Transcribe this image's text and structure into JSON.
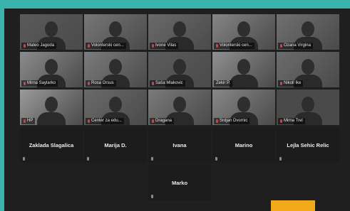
{
  "participants": [
    {
      "label": "Mateo Jagoda",
      "tone": "#5a5a5a"
    },
    {
      "label": "Volonterski cen...",
      "tone": "#777777"
    },
    {
      "label": "Ivone Vilas",
      "tone": "#6a6a6a"
    },
    {
      "label": "Volonterski cen...",
      "tone": "#858585"
    },
    {
      "label": "Ozana Virgina",
      "tone": "#707070"
    },
    {
      "label": "Mirna Saylarko",
      "tone": "#8c8c8c"
    },
    {
      "label": "Rosa Orsus",
      "tone": "#7c7c7c"
    },
    {
      "label": "Saša Mlakovic",
      "tone": "#5c5c5c"
    },
    {
      "label": "Zekir P.",
      "tone": "#909090"
    },
    {
      "label": "Nikoll Ike",
      "tone": "#6c6c6c"
    },
    {
      "label": "HP",
      "tone": "#9a9a9a"
    },
    {
      "label": "Center za edu...",
      "tone": "#6a6a6a"
    },
    {
      "label": "Dragana",
      "tone": "#7a7a7a"
    },
    {
      "label": "Srdjan Dvornic",
      "tone": "#888888"
    },
    {
      "label": "Mirna Trel",
      "tone": "#4a4a4a"
    }
  ],
  "name_tiles": [
    "Zaklada Slagalica",
    "Marija D.",
    "Ivana",
    "Marino",
    "Lejla Sehic Relic"
  ],
  "extra_tile": "Marko",
  "colors": {
    "accent": "#3ab3ae",
    "highlight": "#f2a91a",
    "background": "#1f1f1f"
  }
}
